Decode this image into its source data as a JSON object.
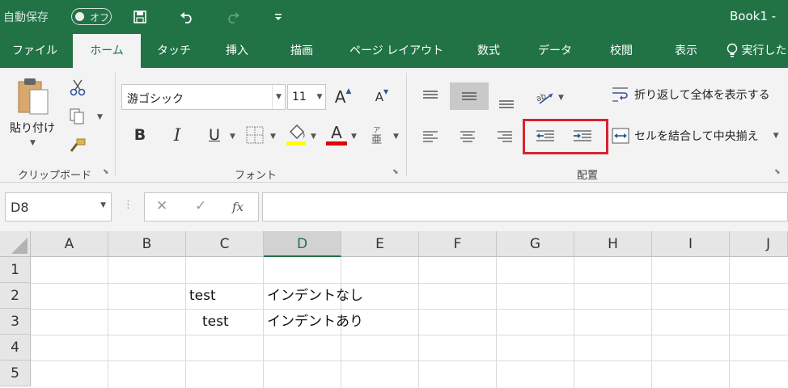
{
  "titlebar": {
    "autosave_label": "自動保存",
    "autosave_state": "オフ",
    "book_title": "Book1  -"
  },
  "tabs": [
    "ファイル",
    "ホーム",
    "タッチ",
    "挿入",
    "描画",
    "ページ レイアウト",
    "数式",
    "データ",
    "校閲",
    "表示",
    "実行した"
  ],
  "active_tab": "ホーム",
  "ribbon": {
    "clipboard": {
      "paste_label": "貼り付け",
      "group_label": "クリップボード"
    },
    "font": {
      "font_name": "游ゴシック",
      "font_size": "11",
      "group_label": "フォント",
      "bold": "B",
      "italic": "I",
      "underline": "U",
      "font_color_glyph": "A",
      "grow_glyph": "A",
      "shrink_glyph": "A"
    },
    "alignment": {
      "wrap_text_label": "折り返して全体を表示する",
      "merge_center_label": "セルを結合して中央揃え",
      "group_label": "配置"
    }
  },
  "formula_bar": {
    "name_box": "D8",
    "cancel": "✕",
    "enter": "✓",
    "fx": "fx",
    "value": ""
  },
  "grid": {
    "columns": [
      "A",
      "B",
      "C",
      "D",
      "E",
      "F",
      "G",
      "H",
      "I",
      "J"
    ],
    "selected_column": "D",
    "rows": [
      "1",
      "2",
      "3",
      "4",
      "5"
    ],
    "cells": {
      "C2": "test",
      "D2": "インデントなし",
      "C3": "test",
      "D3": "インデントあり"
    }
  },
  "colors": {
    "brand": "#217346",
    "highlight": "#d9232d"
  }
}
